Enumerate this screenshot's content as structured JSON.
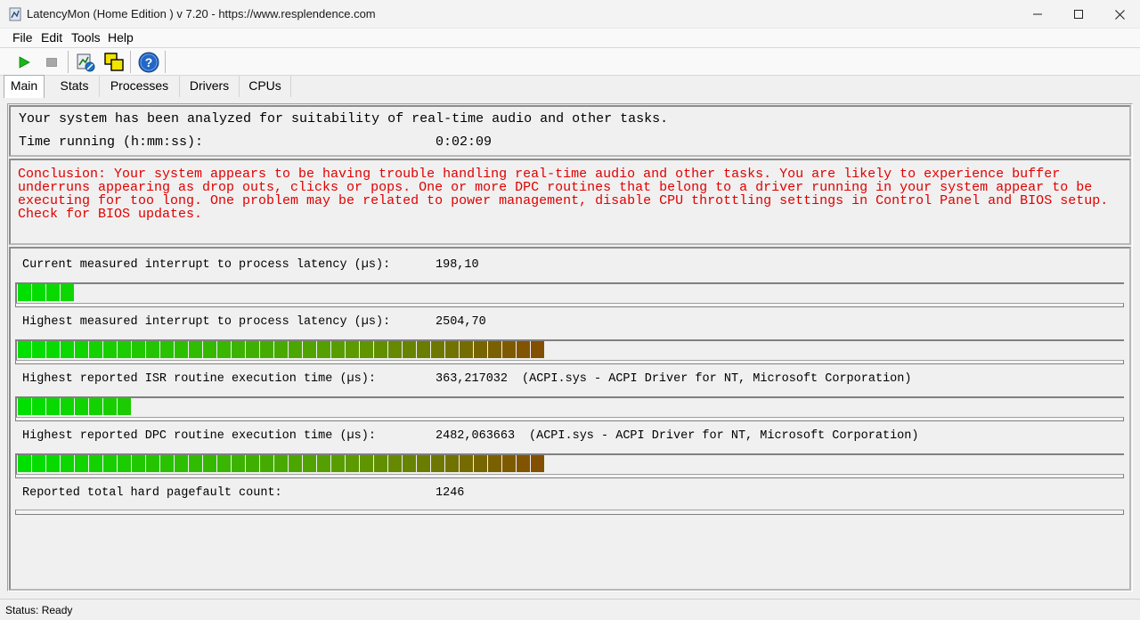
{
  "window": {
    "title": "LatencyMon  (Home Edition )  v 7.20 - https://www.resplendence.com",
    "icon": "latencymon-app-icon"
  },
  "menu": {
    "file": "File",
    "edit": "Edit",
    "tools": "Tools",
    "help": "Help"
  },
  "toolbar": {
    "start_icon": "play-icon",
    "stop_icon": "stop-icon",
    "report_icon": "report-icon",
    "windows_icon": "windows-icon",
    "help_icon": "help-icon"
  },
  "tabs": [
    "Main",
    "Stats",
    "Processes",
    "Drivers",
    "CPUs"
  ],
  "summary": {
    "analyzed_text": "Your system has been analyzed for suitability of real-time audio and other tasks.",
    "time_label": "Time running (h:mm:ss):",
    "time_value": "0:02:09"
  },
  "conclusion": "Conclusion: Your system appears to be having trouble handling real-time audio and other tasks. You are likely to experience buffer underruns appearing as drop outs, clicks or pops. One or more DPC routines that belong to a driver running in your system appear to be executing for too long. One problem may be related to power management, disable CPU throttling settings in Control Panel and BIOS setup. Check for BIOS updates.",
  "metrics": [
    {
      "label": "Current measured interrupt to process latency (µs):",
      "value": "198,10",
      "extra": "",
      "bar_level": 0.05
    },
    {
      "label": "Highest measured interrupt to process latency (µs):",
      "value": "2504,70",
      "extra": "",
      "bar_level": 0.475
    },
    {
      "label": "Highest reported ISR routine execution time (µs):",
      "value": "363,217032",
      "extra": "(ACPI.sys - ACPI Driver for NT, Microsoft Corporation)",
      "bar_level": 0.1
    },
    {
      "label": "Highest reported DPC routine execution time (µs):",
      "value": "2482,063663",
      "extra": "(ACPI.sys - ACPI Driver for NT, Microsoft Corporation)",
      "bar_level": 0.475
    },
    {
      "label": "Reported total hard pagefault count:",
      "value": "1246",
      "extra": "",
      "bar_level": 0
    }
  ],
  "colors": {
    "conclusion_text": "#e00000",
    "bar_start": "#00e000",
    "bar_mid": "#5c9a00",
    "bar_end": "#8a4000"
  },
  "status": "Status: Ready"
}
